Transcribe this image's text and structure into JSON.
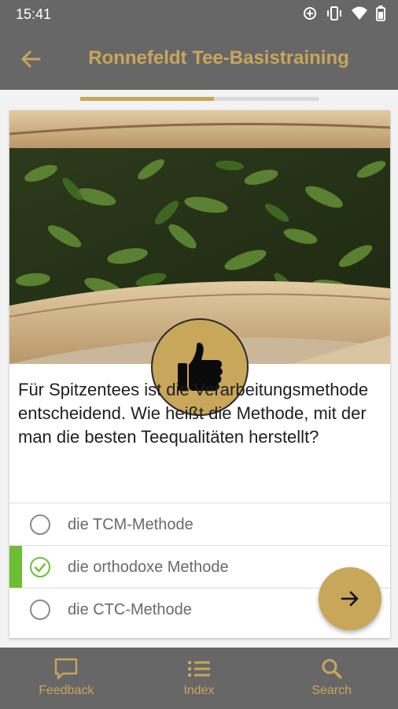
{
  "status": {
    "time": "15:41"
  },
  "header": {
    "title": "Ronnefeldt Tee-Basistraining"
  },
  "progress": {
    "fraction": 0.56
  },
  "question": {
    "text": "Für Spitzentees ist die Verarbeitungsmethode entscheidend. Wie heißt die Methode, mit der man die besten Teequalitäten herstellt?"
  },
  "answers": [
    {
      "label": "die TCM-Methode",
      "selected": false
    },
    {
      "label": "die orthodoxe Methode",
      "selected": true
    },
    {
      "label": "die CTC-Methode",
      "selected": false
    }
  ],
  "nav": {
    "feedback": "Feedback",
    "index": "Index",
    "search": "Search"
  },
  "colors": {
    "accent": "#c8a65a",
    "bar": "#676767",
    "correct": "#6cbf32"
  },
  "icons": {
    "back": "arrow-left-icon",
    "next": "arrow-right-icon",
    "badge": "thumbs-up-icon",
    "feedback": "chat-bubble-icon",
    "index": "list-icon",
    "search": "search-icon"
  }
}
